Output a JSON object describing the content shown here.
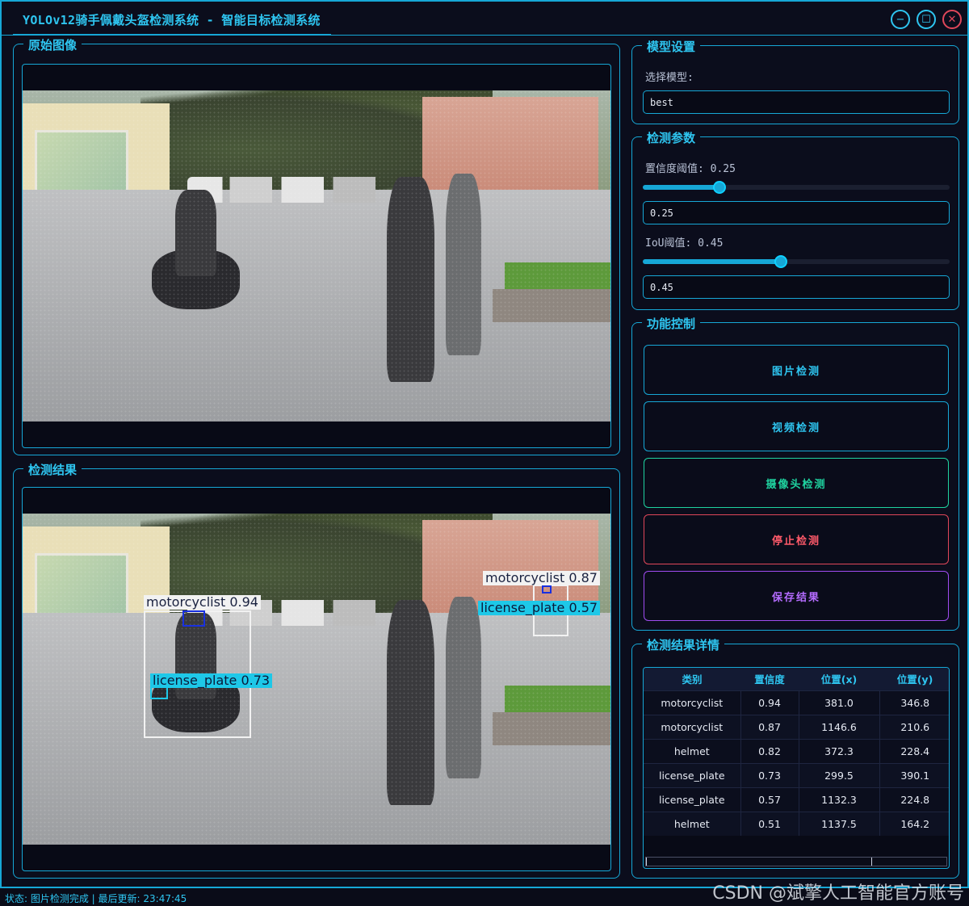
{
  "window": {
    "title": "YOLOv12骑手佩戴头盔检测系统 - 智能目标检测系统",
    "minimize_icon": "−",
    "maximize_icon": "☐",
    "close_icon": "✕"
  },
  "original_panel": {
    "title": "原始图像"
  },
  "result_panel": {
    "title": "检测结果",
    "boxes": [
      {
        "label": "motorcyclist 0.94",
        "style": "white"
      },
      {
        "label": "motorcyclist 0.87",
        "style": "white"
      },
      {
        "label": "license_plate 0.73",
        "style": "cyan"
      },
      {
        "label": "license_plate 0.57",
        "style": "cyan"
      }
    ]
  },
  "model_settings": {
    "title": "模型设置",
    "select_label": "选择模型:",
    "model_value": "best"
  },
  "params": {
    "title": "检测参数",
    "conf_label": "置信度阈值: 0.25",
    "conf_value": "0.25",
    "conf_fraction": 0.25,
    "iou_label": "IoU阈值: 0.45",
    "iou_value": "0.45",
    "iou_fraction": 0.45
  },
  "controls": {
    "title": "功能控制",
    "image_detect": "图片检测",
    "video_detect": "视频检测",
    "camera_detect": "摄像头检测",
    "stop_detect": "停止检测",
    "save_result": "保存结果"
  },
  "details": {
    "title": "检测结果详情",
    "columns": [
      "类别",
      "置信度",
      "位置(x)",
      "位置(y)"
    ],
    "rows": [
      [
        "motorcyclist",
        "0.94",
        "381.0",
        "346.8"
      ],
      [
        "motorcyclist",
        "0.87",
        "1146.6",
        "210.6"
      ],
      [
        "helmet",
        "0.82",
        "372.3",
        "228.4"
      ],
      [
        "license_plate",
        "0.73",
        "299.5",
        "390.1"
      ],
      [
        "license_plate",
        "0.57",
        "1132.3",
        "224.8"
      ],
      [
        "helmet",
        "0.51",
        "1137.5",
        "164.2"
      ]
    ]
  },
  "status_bar": {
    "text": "状态: 图片检测完成 | 最后更新: 23:47:45"
  },
  "watermark": "CSDN @斌擎人工智能官方账号",
  "colors": {
    "accent": "#16a7d6",
    "image_btn": "#16a7d6",
    "video_btn": "#16a7d6",
    "camera_btn": "#1fd3a0",
    "stop_btn": "#e0475a",
    "save_btn": "#a04cf0"
  }
}
